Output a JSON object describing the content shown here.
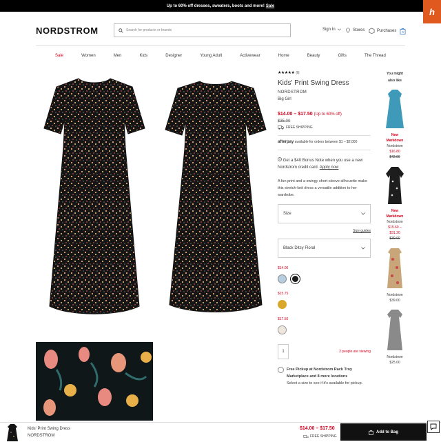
{
  "promo": {
    "text": "Up to 60% off dresses, sweaters, boots and more!",
    "link": "Sale"
  },
  "header": {
    "logo": "NORDSTROM",
    "search_placeholder": "Search for products or brands",
    "sign_in": "Sign In",
    "stores": "Stores",
    "purchases": "Purchases",
    "bag_count": "0"
  },
  "nav": [
    "Sale",
    "Women",
    "Men",
    "Kids",
    "Designer",
    "Young Adult",
    "Activewear",
    "Home",
    "Beauty",
    "Gifts",
    "The Thread"
  ],
  "product": {
    "rating_count": "(6)",
    "title": "Kids' Print Swing Dress",
    "brand": "NORDSTROM",
    "category": "Big Girl",
    "price": "$14.00 – $17.50",
    "discount": "(Up to 60% off)",
    "original": "$35.00",
    "shipping": "FREE SHIPPING",
    "afterpay_logo": "afterpay",
    "afterpay_text": "available for orders between $1 – $2,000",
    "note_text": "Get a $40 Bonus Note when you use a new Nordstrom credit card.",
    "note_link": "Apply now",
    "description": "A fun print and a swingy short-sleeve silhouette make this stretch-knit dress a versatile addition to her wardrobe.",
    "size_label": "Size",
    "size_guide": "Size guides",
    "color_value": "Black Ditsy Floral",
    "swatch_price_1": "$14.00",
    "swatch_price_2": "$15.75",
    "swatch_price_3": "$17.50",
    "qty": "1",
    "viewing": "2 people are viewing",
    "pickup_title": "Free Pickup at Nordstrom Rack Troy Marketplace and 8 more locations",
    "pickup_sub": "Select a size to see if it's available for pickup."
  },
  "recommendations": {
    "heading": "You might also like",
    "items": [
      {
        "new": "New Markdown",
        "brand": "Nordstrom",
        "price": "$16.80",
        "original": "$42.00"
      },
      {
        "new": "New Markdown",
        "brand": "Nordstrom",
        "price": "$15.60 – $31.20",
        "original": "$39.00"
      },
      {
        "new": "",
        "brand": "Nordstrom",
        "price": "$39.00",
        "original": ""
      },
      {
        "new": "",
        "brand": "Nordstrom",
        "price": "$25.00",
        "original": ""
      }
    ]
  },
  "bottom_bar": {
    "name": "Kids' Print Swing Dress",
    "brand": "NORDSTROM",
    "price": "$14.00 – $17.50",
    "shipping": "FREE SHIPPING",
    "add_button": "Add to Bag"
  },
  "colors": {
    "sale_red": "#d6001c",
    "promo_bg": "#000000",
    "widget_orange": "#e05a1f"
  },
  "icons": [
    "search-icon",
    "chevron-down-icon",
    "store-icon",
    "purchases-icon",
    "bag-icon",
    "truck-icon",
    "info-icon",
    "chat-icon"
  ]
}
